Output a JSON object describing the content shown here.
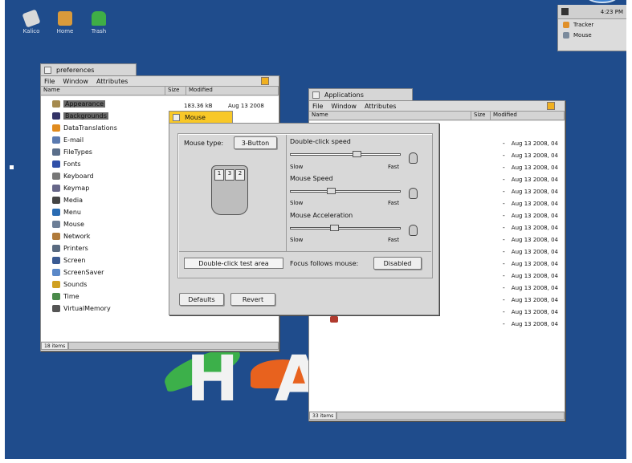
{
  "desktop": {
    "icons": [
      {
        "label": "Kalico",
        "color": "#d9d9d9"
      },
      {
        "label": "Home",
        "color": "#d99a3b"
      },
      {
        "label": "Trash",
        "color": "#3fae46"
      }
    ],
    "logo_letters": [
      "H",
      "A"
    ]
  },
  "deskbar": {
    "time": "4:23 PM",
    "items": [
      {
        "label": "Tracker",
        "color": "#e0902a"
      },
      {
        "label": "Mouse",
        "color": "#7a8a9c"
      }
    ]
  },
  "preferences_window": {
    "title": "preferences",
    "menus": [
      "File",
      "Window",
      "Attributes"
    ],
    "columns": [
      "Name",
      "Size",
      "Modified"
    ],
    "date_fragment": "Aug 13 2008",
    "size_fragment": "183.36 kB",
    "items": [
      {
        "label": "Appearance",
        "color": "#a58a4e"
      },
      {
        "label": "Backgrounds",
        "color": "#333366"
      },
      {
        "label": "DataTranslations",
        "color": "#e08b1e"
      },
      {
        "label": "E-mail",
        "color": "#5a7ab0"
      },
      {
        "label": "FileTypes",
        "color": "#5a6e8a"
      },
      {
        "label": "Fonts",
        "color": "#3050a8"
      },
      {
        "label": "Keyboard",
        "color": "#777777"
      },
      {
        "label": "Keymap",
        "color": "#666688"
      },
      {
        "label": "Media",
        "color": "#444444"
      },
      {
        "label": "Menu",
        "color": "#2a6cb3"
      },
      {
        "label": "Mouse",
        "color": "#6c7e96"
      },
      {
        "label": "Network",
        "color": "#b07a3a"
      },
      {
        "label": "Printers",
        "color": "#596a80"
      },
      {
        "label": "Screen",
        "color": "#3a5a92"
      },
      {
        "label": "ScreenSaver",
        "color": "#5a88c8"
      },
      {
        "label": "Sounds",
        "color": "#d0a020"
      },
      {
        "label": "Time",
        "color": "#4a8a4a"
      },
      {
        "label": "VirtualMemory",
        "color": "#555555"
      }
    ],
    "status_count": "18 items"
  },
  "applications_window": {
    "title": "Applications",
    "menus": [
      "File",
      "Window",
      "Attributes"
    ],
    "columns": [
      "Name",
      "Size",
      "Modified"
    ],
    "dates": [
      "Aug 13 2008, 04",
      "Aug 13 2008, 04",
      "Aug 13 2008, 04",
      "Aug 13 2008, 04",
      "Aug 13 2008, 04",
      "Aug 13 2008, 04",
      "Aug 13 2008, 04",
      "Aug 13 2008, 04",
      "Aug 13 2008, 04",
      "Aug 13 2008, 04",
      "Aug 13 2008, 04",
      "Aug 13 2008, 04",
      "Aug 13 2008, 04",
      "Aug 13 2008, 04",
      "Aug 13 2008, 04",
      "Aug 13 2008, 04"
    ],
    "status_count": "33 items"
  },
  "mouse_window": {
    "title": "Mouse",
    "mouse_type_label": "Mouse type:",
    "mouse_type_value": "3-Button",
    "button_numbers": [
      "1",
      "3",
      "2"
    ],
    "double_click_speed_label": "Double-click speed",
    "mouse_speed_label": "Mouse Speed",
    "mouse_acceleration_label": "Mouse Acceleration",
    "slow_label": "Slow",
    "fast_label": "Fast",
    "double_click_speed_value": 0.6,
    "mouse_speed_value": 0.37,
    "mouse_acceleration_value": 0.4,
    "test_area_label": "Double-click test area",
    "focus_label": "Focus follows mouse:",
    "focus_value": "Disabled",
    "defaults_label": "Defaults",
    "revert_label": "Revert"
  }
}
